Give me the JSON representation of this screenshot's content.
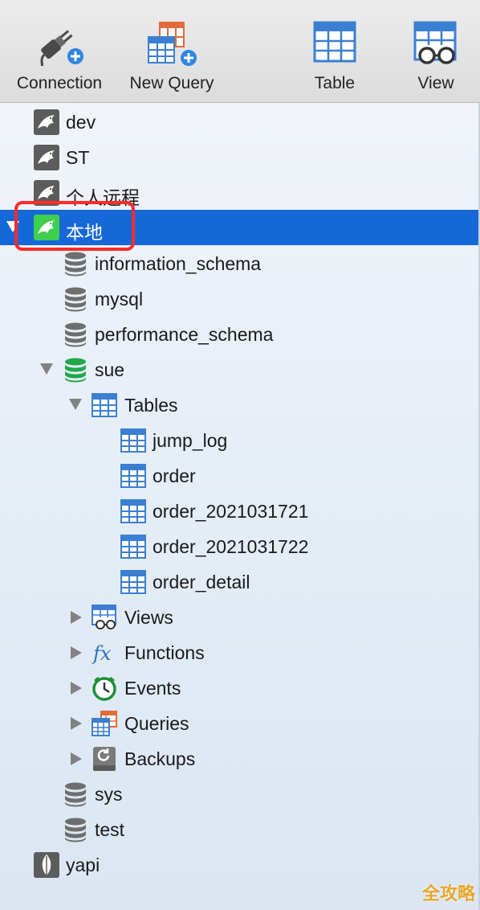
{
  "toolbar": {
    "connection_label": "Connection",
    "new_query_label": "New Query",
    "table_label": "Table",
    "view_label": "View"
  },
  "tree": {
    "connections": [
      {
        "label": "dev",
        "icon": "mysql-dolphin-icon"
      },
      {
        "label": "ST",
        "icon": "mysql-dolphin-icon"
      },
      {
        "label": "个人远程",
        "icon": "mysql-dolphin-icon"
      },
      {
        "label": "本地",
        "icon": "mysql-dolphin-icon",
        "selected": true,
        "expanded": true
      }
    ],
    "databases": [
      {
        "label": "information_schema"
      },
      {
        "label": "mysql"
      },
      {
        "label": "performance_schema"
      },
      {
        "label": "sue",
        "expanded": true
      }
    ],
    "tables_group": {
      "label": "Tables",
      "expanded": true
    },
    "tables": [
      {
        "label": "jump_log"
      },
      {
        "label": "order"
      },
      {
        "label": "order_2021031721"
      },
      {
        "label": "order_2021031722"
      },
      {
        "label": "order_detail"
      }
    ],
    "object_groups": [
      {
        "label": "Views",
        "icon": "view-icon"
      },
      {
        "label": "Functions",
        "icon": "function-icon"
      },
      {
        "label": "Events",
        "icon": "clock-icon"
      },
      {
        "label": "Queries",
        "icon": "query-icon"
      },
      {
        "label": "Backups",
        "icon": "backup-icon"
      }
    ],
    "other_databases": [
      {
        "label": "sys"
      },
      {
        "label": "test"
      }
    ],
    "other_connections": [
      {
        "label": "yapi",
        "icon": "mongodb-leaf-icon"
      }
    ]
  },
  "watermark": "全攻略",
  "colors": {
    "selection": "#1668d8",
    "highlight_box": "#ff2b2b",
    "db_active": "#1fa84a",
    "table_icon": "#3b7fd2"
  }
}
